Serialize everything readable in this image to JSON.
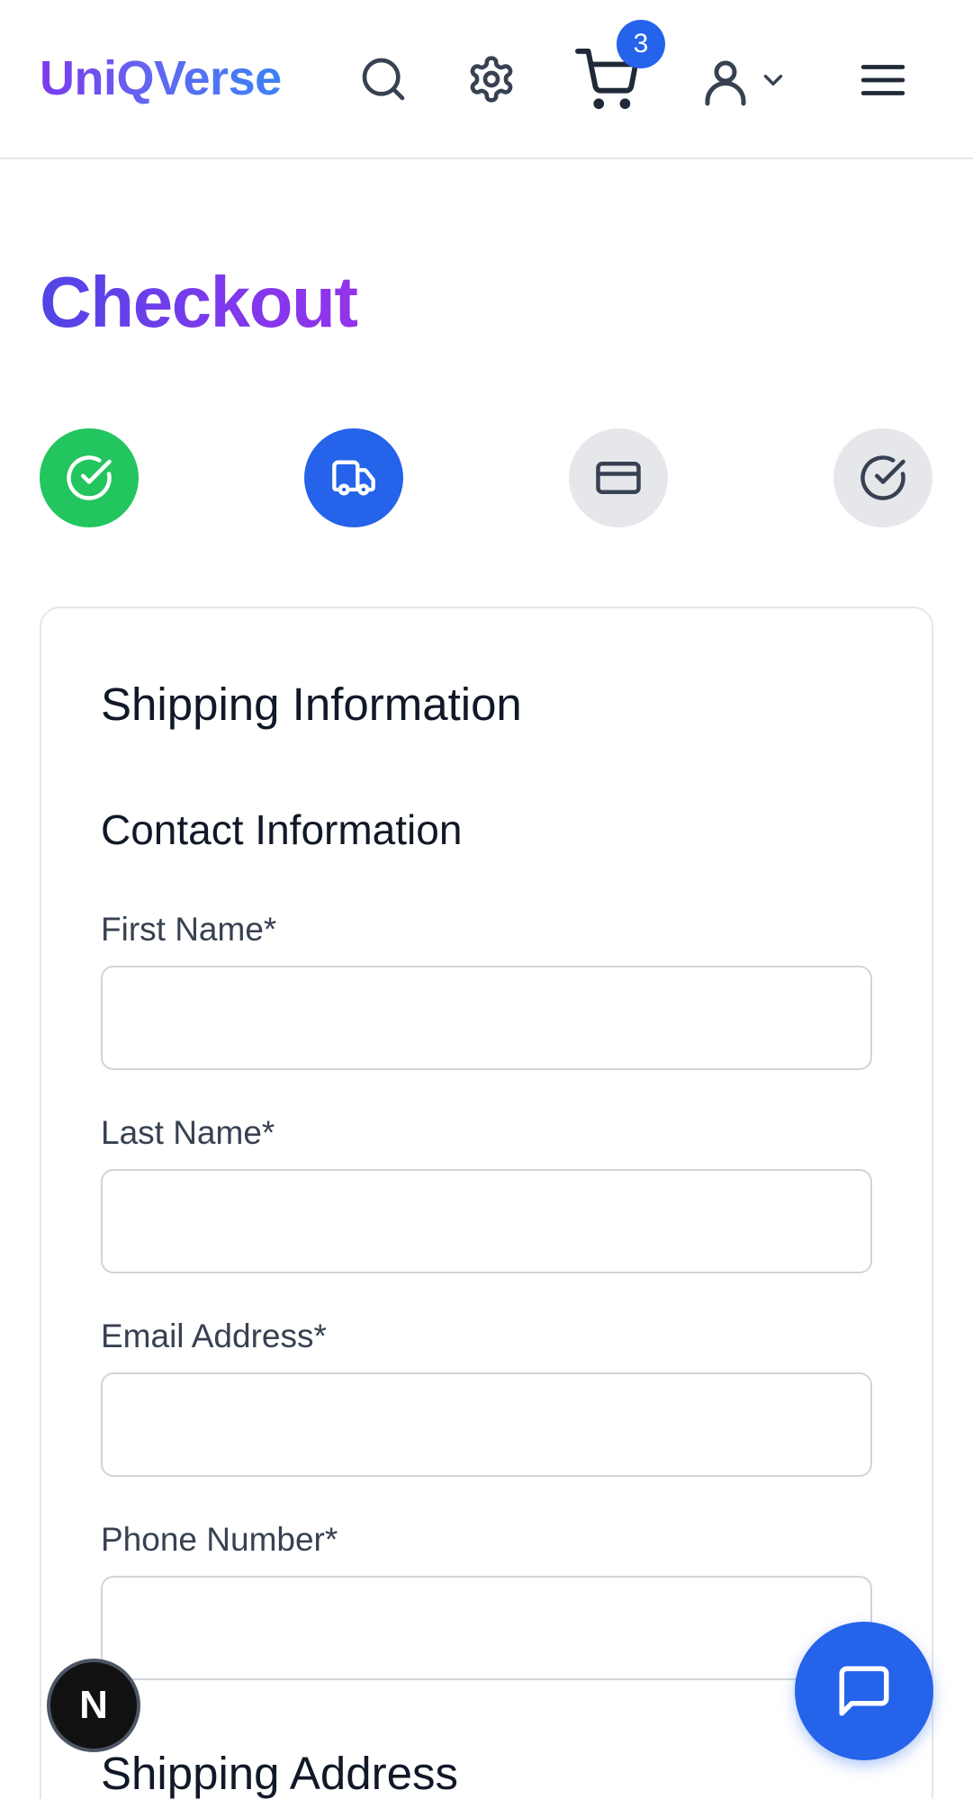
{
  "header": {
    "brand": "UniQVerse",
    "cart_count": "3",
    "icons": [
      "search-icon",
      "gear-icon",
      "cart-icon",
      "user-icon",
      "chevron-down-icon",
      "menu-icon"
    ]
  },
  "page": {
    "title": "Checkout"
  },
  "steps": [
    {
      "icon": "check-circle-icon",
      "state": "completed",
      "color": "#22c55e"
    },
    {
      "icon": "truck-icon",
      "state": "active",
      "color": "#2563eb"
    },
    {
      "icon": "credit-card-icon",
      "state": "upcoming",
      "color": "#e5e7eb"
    },
    {
      "icon": "check-circle-icon",
      "state": "upcoming",
      "color": "#e5e7eb"
    }
  ],
  "form": {
    "section_title": "Shipping Information",
    "contact_title": "Contact Information",
    "fields": {
      "first_name": {
        "label": "First Name*",
        "value": ""
      },
      "last_name": {
        "label": "Last Name*",
        "value": ""
      },
      "email": {
        "label": "Email Address*",
        "value": ""
      },
      "phone": {
        "label": "Phone Number*",
        "value": ""
      }
    },
    "shipping_address_title": "Shipping Address"
  },
  "floating": {
    "framework_badge": "N",
    "chat_icon": "chat-bubble-icon"
  },
  "colors": {
    "accent": "#2563eb",
    "success": "#22c55e",
    "inactive": "#e5e7eb"
  }
}
